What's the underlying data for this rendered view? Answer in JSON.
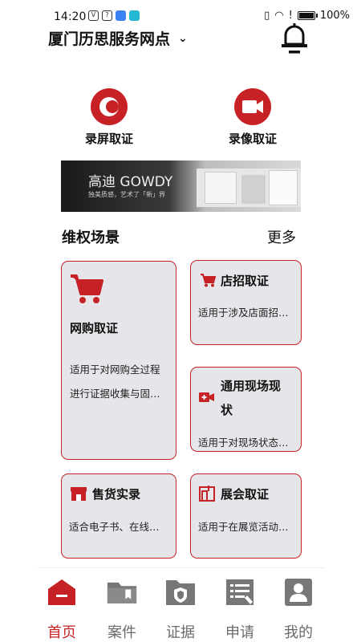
{
  "status_bar": {
    "time": "14:20",
    "battery": "100%"
  },
  "header": {
    "title": "厦门历思服务网点",
    "chevron": "⌄"
  },
  "quick_actions": [
    {
      "label": "录屏取证",
      "icon": "screen-record-icon"
    },
    {
      "label": "录像取证",
      "icon": "video-camera-icon"
    }
  ],
  "banner": {
    "brand": "高迪 GOWDY",
    "sub": "独美质感，艺术了「新」界",
    "fine": ""
  },
  "section": {
    "title": "维权场景",
    "more": "更多"
  },
  "cards": {
    "online": {
      "title": "网购取证",
      "desc_line1": "适用于对网购全过程",
      "desc_line2": "进行证据收集与固…",
      "icon": "shopping-cart-icon"
    },
    "shop": {
      "title": "店招取证",
      "desc": "适用于涉及店面招…",
      "icon": "shopping-cart-icon"
    },
    "scene_title_line1": "通用现场现",
    "scene_title_line2": "状",
    "scene": {
      "desc": "适用于对现场状态…",
      "icon": "video-add-icon"
    },
    "sale": {
      "title": "售货实录",
      "desc": "适合电子书、在线…",
      "icon": "store-icon"
    },
    "expo": {
      "title": "展会取证",
      "desc": "适用于在展览活动…",
      "icon": "booth-icon"
    }
  },
  "nav": [
    {
      "label": "首页",
      "icon": "home-icon",
      "active": true
    },
    {
      "label": "案件",
      "icon": "folder-icon",
      "active": false
    },
    {
      "label": "证据",
      "icon": "evidence-shield-icon",
      "active": false
    },
    {
      "label": "申请",
      "icon": "application-form-icon",
      "active": false
    },
    {
      "label": "我的",
      "icon": "profile-icon",
      "active": false
    }
  ],
  "colors": {
    "accent": "#c62125",
    "card_bg": "#e6e6ea",
    "nav_gray": "#6a6a6a"
  }
}
